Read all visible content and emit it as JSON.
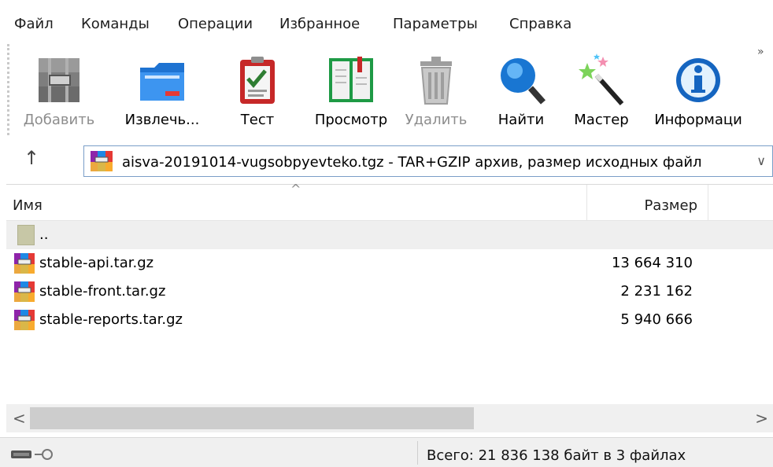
{
  "menu": [
    "Файл",
    "Команды",
    "Операции",
    "Избранное",
    "Параметры",
    "Справка"
  ],
  "toolbar": {
    "add": "Добавить",
    "extract": "Извлечь...",
    "test": "Тест",
    "view": "Просмотр",
    "delete": "Удалить",
    "find": "Найти",
    "wizard": "Мастер",
    "info": "Информаци",
    "more": "»"
  },
  "address": {
    "text": "aisva-20191014-vugsobpyevteko.tgz - TAR+GZIP архив, размер исходных файл",
    "dropdown": "∨",
    "up": "↑"
  },
  "list": {
    "headers": {
      "name": "Имя",
      "size": "Размер"
    },
    "rows": [
      {
        "name": "..",
        "size": ""
      },
      {
        "name": "stable-api.tar.gz",
        "size": "13 664 310"
      },
      {
        "name": "stable-front.tar.gz",
        "size": "2 231 162"
      },
      {
        "name": "stable-reports.tar.gz",
        "size": "5 940 666"
      }
    ]
  },
  "scroll": {
    "left": "<",
    "right": ">"
  },
  "status": {
    "summary": "Всего: 21 836 138 байт в 3 файлах"
  }
}
